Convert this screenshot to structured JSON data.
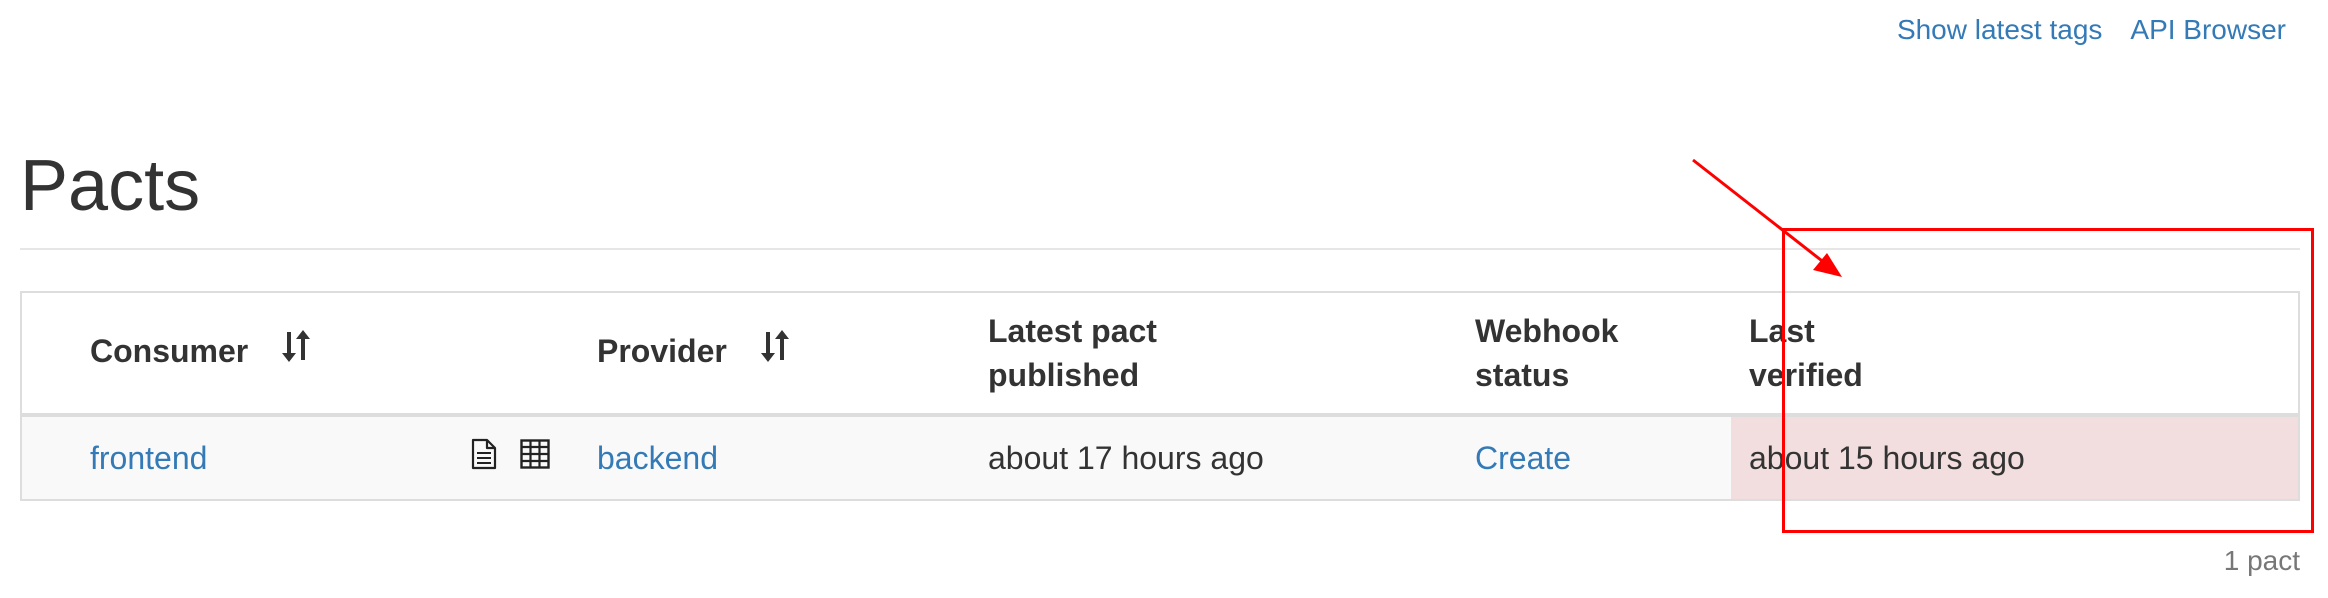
{
  "nav": {
    "show_latest_tags": "Show latest tags",
    "api_browser": "API Browser"
  },
  "page": {
    "title": "Pacts"
  },
  "table": {
    "headers": {
      "consumer": "Consumer",
      "provider": "Provider",
      "latest_pact_published": [
        "Latest pact",
        "published"
      ],
      "webhook_status": [
        "Webhook",
        "status"
      ],
      "last_verified": [
        "Last",
        "verified"
      ]
    },
    "rows": [
      {
        "consumer": "frontend",
        "provider": "backend",
        "latest_pact_published": "about 17 hours ago",
        "webhook_status": "Create",
        "last_verified": "about 15 hours ago",
        "icons": [
          "document-icon",
          "matrix-table-icon"
        ]
      }
    ]
  },
  "footer": {
    "count": "1 pact"
  },
  "colors": {
    "link": "#337ab7",
    "verified_highlight": "#f2dede",
    "annotation": "#ff0000"
  }
}
